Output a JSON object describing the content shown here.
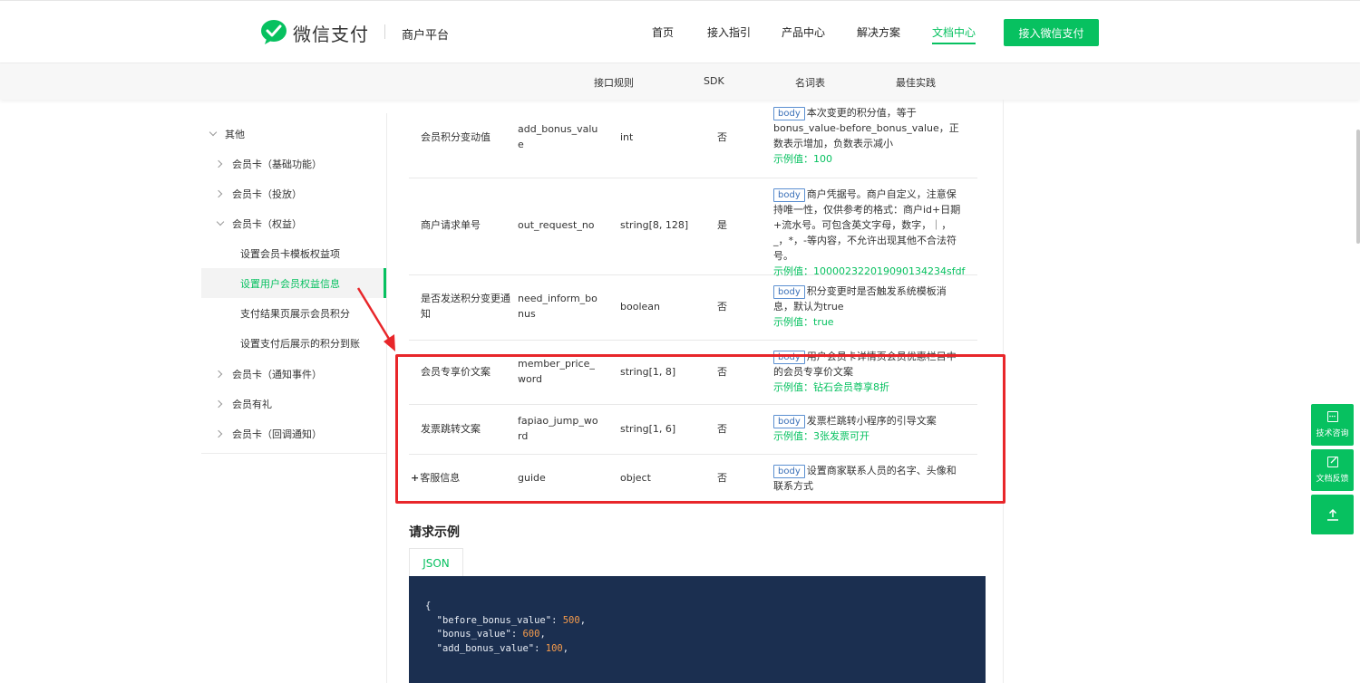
{
  "header": {
    "logo_text": "微信支付",
    "platform": "商户平台",
    "nav": [
      {
        "label": "首页",
        "name": "nav-home"
      },
      {
        "label": "接入指引",
        "name": "nav-guide"
      },
      {
        "label": "产品中心",
        "name": "nav-products"
      },
      {
        "label": "解决方案",
        "name": "nav-solutions"
      },
      {
        "label": "文档中心",
        "name": "nav-docs",
        "active": true
      }
    ],
    "cta_label": "接入微信支付"
  },
  "subnav": [
    "接口规则",
    "SDK",
    "名词表",
    "最佳实践"
  ],
  "sidebar": {
    "items": [
      {
        "label": "其他",
        "level": 0,
        "expanded": true
      },
      {
        "label": "会员卡（基础功能）",
        "level": 1,
        "expanded": false
      },
      {
        "label": "会员卡（投放）",
        "level": 1,
        "expanded": false
      },
      {
        "label": "会员卡（权益）",
        "level": 1,
        "expanded": true
      },
      {
        "label": "设置会员卡模板权益项",
        "level": 2
      },
      {
        "label": "设置用户会员权益信息",
        "level": 2,
        "active": true
      },
      {
        "label": "支付结果页展示会员积分",
        "level": 2
      },
      {
        "label": "设置支付后展示的积分到账",
        "level": 2
      },
      {
        "label": "会员卡（通知事件）",
        "level": 1,
        "expanded": false
      },
      {
        "label": "会员有礼",
        "level": 1,
        "expanded": false
      },
      {
        "label": "会员卡（回调通知）",
        "level": 1,
        "expanded": false
      }
    ]
  },
  "params": {
    "tag": "body",
    "example_prefix": "示例值：",
    "rows": [
      {
        "name": "会员积分变动值",
        "field": "add_bonus_value",
        "type": "int",
        "required": "否",
        "desc": "本次变更的积分值，等于bonus_value-before_bonus_value，正数表示增加，负数表示减小",
        "example": "100"
      },
      {
        "name": "商户请求单号",
        "field": "out_request_no",
        "type": "string[8, 128]",
        "required": "是",
        "desc": "商户凭据号。商户自定义，注意保持唯一性，仅供参考的格式：商户id+日期+流水号。可包含英文字母，数字，｜，_，*，-等内容，不允许出现其他不合法符号。",
        "example": "10000232201909013423​4sfdf"
      },
      {
        "name": "是否发送积分变更通知",
        "field": "need_inform_bonus",
        "type": "boolean",
        "required": "否",
        "desc": "积分变更时是否触发系统模板消息，默认为true",
        "example": "true"
      },
      {
        "name": "会员专享价文案",
        "field": "member_price_word",
        "type": "string[1, 8]",
        "required": "否",
        "desc": "用户会员卡详情页会员优惠栏目中的会员专享价文案",
        "example": "钻石会员尊享8折"
      },
      {
        "name": "发票跳转文案",
        "field": "fapiao_jump_word",
        "type": "string[1, 6]",
        "required": "否",
        "desc": "发票栏跳转小程序的引导文案",
        "example": "3张发票可开"
      },
      {
        "name": "客服信息",
        "field": "guide",
        "type": "object",
        "required": "否",
        "desc": "设置商家联系人员的名字、头像和联系方式",
        "example": "",
        "expandable": true
      }
    ]
  },
  "request_example": {
    "title": "请求示例",
    "tab": "JSON",
    "code_lines": [
      {
        "text": "{",
        "num": ""
      },
      {
        "text": "  \"before_bonus_value\": ",
        "num": "500"
      },
      {
        "text": "  \"bonus_value\": ",
        "num": "600"
      },
      {
        "text": "  \"add_bonus_value\": ",
        "num": "100"
      }
    ]
  },
  "float_buttons": [
    {
      "label": "技术咨询",
      "icon": "chat-icon"
    },
    {
      "label": "文档反馈",
      "icon": "edit-icon"
    },
    {
      "label": "",
      "icon": "arrow-up-icon"
    }
  ],
  "colors": {
    "brand": "#07c160",
    "highlight": "#e8262a",
    "code_bg": "#1b2f50",
    "tag_border": "#5b8fd1"
  }
}
